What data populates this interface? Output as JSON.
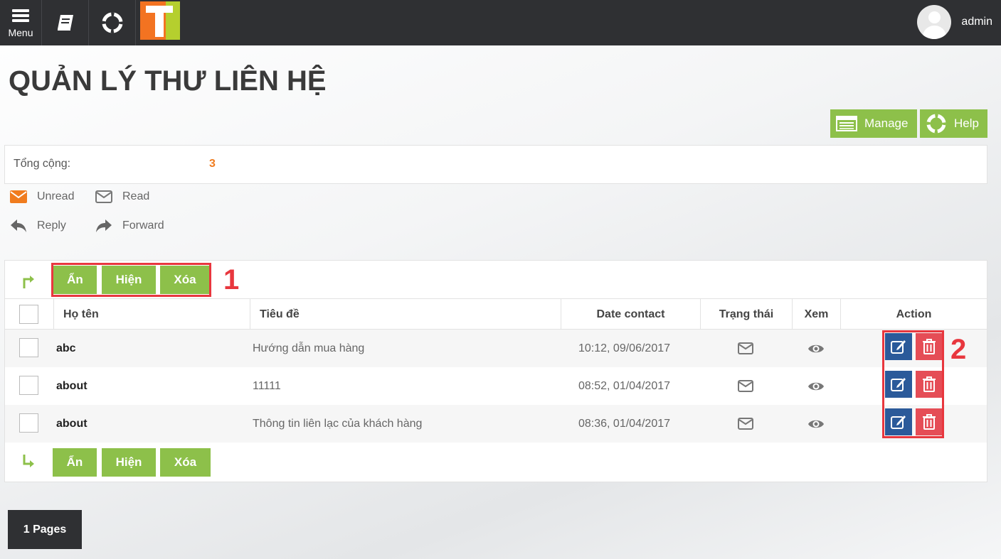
{
  "topbar": {
    "menu_label": "Menu",
    "icons": [
      "hamburger-menu-icon",
      "book-icon",
      "lifebuoy-icon"
    ],
    "username": "admin"
  },
  "page": {
    "title": "QUẢN LÝ THƯ LIÊN HỆ"
  },
  "toolbar": {
    "manage_label": "Manage",
    "help_label": "Help"
  },
  "summary": {
    "total_label": "Tổng cộng:",
    "total_value": "3"
  },
  "legend": {
    "unread": "Unread",
    "read": "Read",
    "reply": "Reply",
    "forward": "Forward"
  },
  "bulk_actions": {
    "hide": "Ẩn",
    "show": "Hiện",
    "delete": "Xóa"
  },
  "table": {
    "columns": {
      "name": "Họ tên",
      "subject": "Tiêu đề",
      "date": "Date contact",
      "status": "Trạng thái",
      "view": "Xem",
      "action": "Action"
    },
    "rows": [
      {
        "name": "abc",
        "subject": "Hướng dẫn mua hàng",
        "date": "10:12, 09/06/2017"
      },
      {
        "name": "about",
        "subject": "11111",
        "date": "08:52, 01/04/2017"
      },
      {
        "name": "about",
        "subject": "Thông tin liên lạc của khách hàng",
        "date": "08:36, 01/04/2017"
      }
    ]
  },
  "annotations": {
    "one": "1",
    "two": "2"
  },
  "pagination": {
    "label": "1 Pages"
  },
  "colors": {
    "accent_green": "#8dc04a",
    "topbar": "#2f3033",
    "edit_blue": "#2b5a9a",
    "delete_red": "#e54d56",
    "highlight_red": "#e8373e",
    "count_orange": "#f07c1f"
  }
}
